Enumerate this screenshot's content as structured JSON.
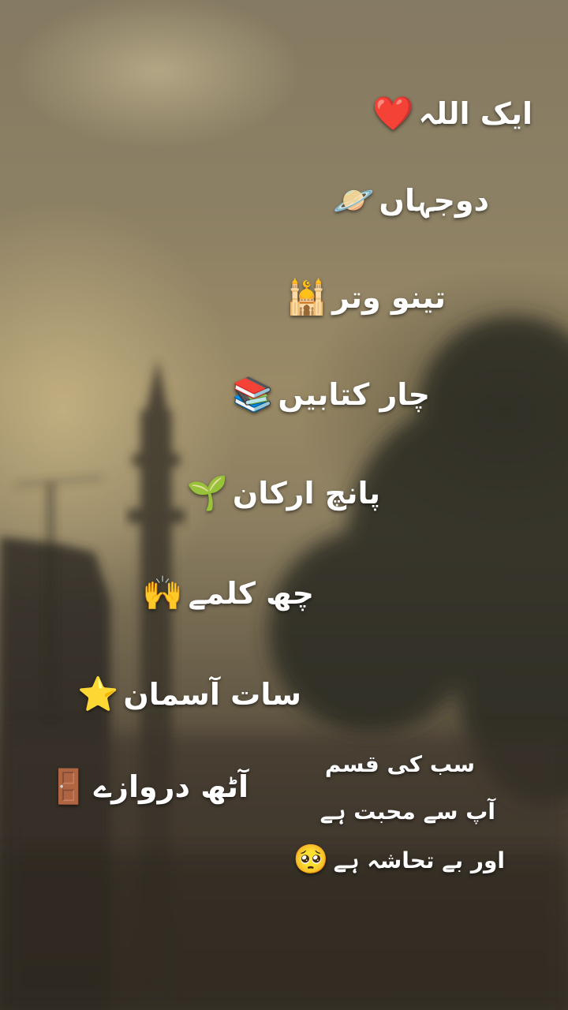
{
  "lines": [
    {
      "text": "ایک اللہ",
      "icon": "heart-icon",
      "glyph": "❤️"
    },
    {
      "text": "دوجہاں",
      "icon": "ringed-planet-icon",
      "glyph": "🪐"
    },
    {
      "text": "تینو وتر",
      "icon": "mosque-icon",
      "glyph": "🕌"
    },
    {
      "text": "چار کتابیں",
      "icon": "books-icon",
      "glyph": "📚"
    },
    {
      "text": "پانچ ارکان",
      "icon": "seedling-icon",
      "glyph": "🌱"
    },
    {
      "text": "چھ کلمے",
      "icon": "raised-hands-icon",
      "glyph": "🙌"
    },
    {
      "text": "سات آسمان",
      "icon": "star-icon",
      "glyph": "⭐"
    },
    {
      "text": "آٹھ دروازے",
      "icon": "door-icon",
      "glyph": "🚪"
    }
  ],
  "quote": {
    "line1": "سب کی قسم",
    "line2": "آپ سے محبت ہے",
    "line3": "اور بے تحاشہ ہے",
    "icon": "pleading-face-icon",
    "glyph": "🥺"
  }
}
